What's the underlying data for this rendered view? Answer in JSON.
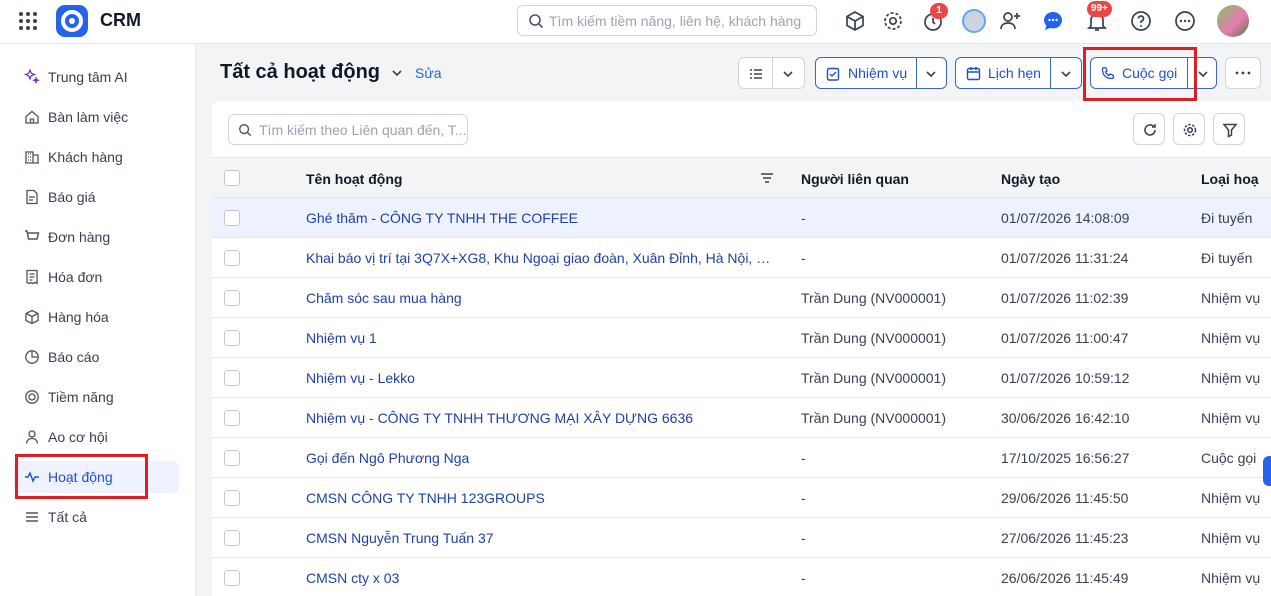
{
  "app": {
    "name": "CRM"
  },
  "top_search": {
    "placeholder": "Tìm kiếm tiềm năng, liên hệ, khách hàng"
  },
  "badges": {
    "timer": "1",
    "notifications": "99+"
  },
  "sidebar": {
    "items": [
      {
        "label": "Trung tâm AI",
        "icon": "sparkle-icon"
      },
      {
        "label": "Bàn làm việc",
        "icon": "home-icon"
      },
      {
        "label": "Khách hàng",
        "icon": "building-icon"
      },
      {
        "label": "Báo giá",
        "icon": "quote-icon"
      },
      {
        "label": "Đơn hàng",
        "icon": "cart-icon"
      },
      {
        "label": "Hóa đơn",
        "icon": "invoice-icon"
      },
      {
        "label": "Hàng hóa",
        "icon": "box-icon"
      },
      {
        "label": "Báo cáo",
        "icon": "chart-icon"
      },
      {
        "label": "Tiềm năng",
        "icon": "target-icon"
      },
      {
        "label": "Ao cơ hội",
        "icon": "opportunity-icon"
      },
      {
        "label": "Hoạt động",
        "icon": "activity-icon",
        "active": true
      },
      {
        "label": "Tất cả",
        "icon": "menu-icon"
      }
    ]
  },
  "page": {
    "title": "Tất cả hoạt động",
    "edit_label": "Sửa"
  },
  "toolbar": {
    "task_label": "Nhiệm vụ",
    "appointment_label": "Lịch hẹn",
    "call_label": "Cuộc gọi"
  },
  "table_search": {
    "placeholder": "Tìm kiếm theo Liên quan đến, T..."
  },
  "table": {
    "columns": [
      "Tên hoạt động",
      "Người liên quan",
      "Ngày tạo",
      "Loại hoạ"
    ],
    "rows": [
      {
        "name": "Ghé thăm - CÔNG TY TNHH THE COFFEE",
        "related": "-",
        "created": "01/07/2026 14:08:09",
        "type": "Đi tuyến"
      },
      {
        "name": "Khai báo vị trí tại 3Q7X+XG8, Khu Ngoại giao đoàn, Xuân Đỉnh, Hà Nội, Vi...",
        "related": "-",
        "created": "01/07/2026 11:31:24",
        "type": "Đi tuyến"
      },
      {
        "name": "Chăm sóc sau mua hàng",
        "related": "Trần Dung (NV000001)",
        "created": "01/07/2026 11:02:39",
        "type": "Nhiệm vụ"
      },
      {
        "name": "Nhiệm vụ 1",
        "related": "Trần Dung (NV000001)",
        "created": "01/07/2026 11:00:47",
        "type": "Nhiệm vụ"
      },
      {
        "name": "Nhiệm vụ - Lekko",
        "related": "Trần Dung (NV000001)",
        "created": "01/07/2026 10:59:12",
        "type": "Nhiệm vụ"
      },
      {
        "name": "Nhiệm vụ - CÔNG TY TNHH THƯƠNG MẠI XÂY DỰNG 6636",
        "related": "Trần Dung (NV000001)",
        "created": "30/06/2026 16:42:10",
        "type": "Nhiệm vụ"
      },
      {
        "name": "Gọi đến Ngô Phương Nga",
        "related": "-",
        "created": "17/10/2025 16:56:27",
        "type": "Cuộc gọi"
      },
      {
        "name": "CMSN CÔNG TY TNHH 123GROUPS",
        "related": "-",
        "created": "29/06/2026 11:45:50",
        "type": "Nhiệm vụ"
      },
      {
        "name": "CMSN Nguyễn Trung Tuấn 37",
        "related": "-",
        "created": "27/06/2026 11:45:23",
        "type": "Nhiệm vụ"
      },
      {
        "name": "CMSN cty x 03",
        "related": "-",
        "created": "26/06/2026 11:45:49",
        "type": "Nhiệm vụ"
      }
    ]
  }
}
